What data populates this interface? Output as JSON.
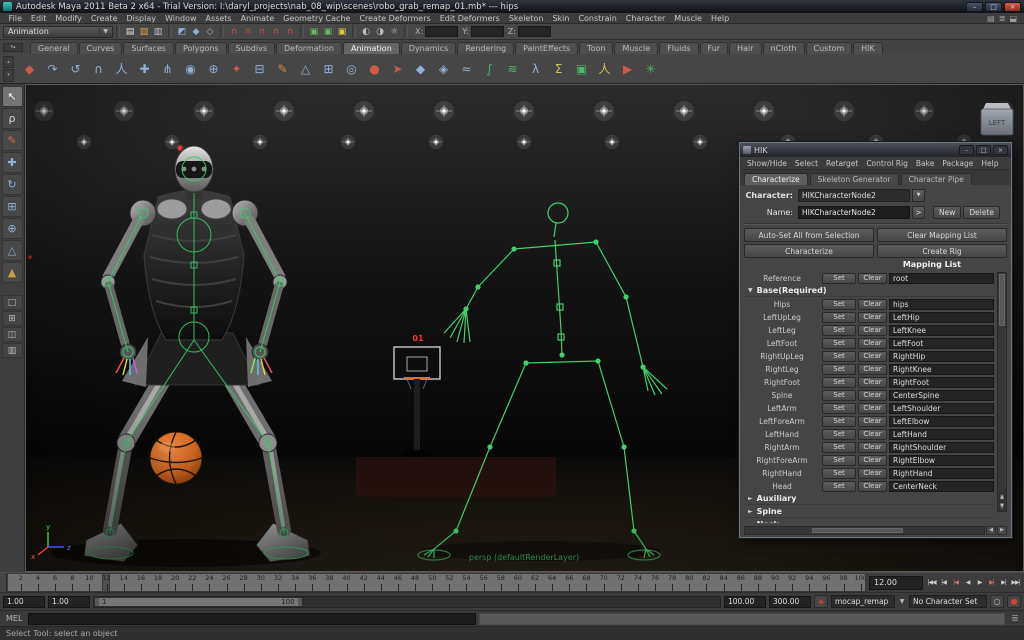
{
  "title_bar": {
    "title": "Autodesk Maya 2011 Beta 2 x64 - Trial Version: I:\\daryl_projects\\nab_08_wip\\scenes\\robo_grab_remap_01.mb*   ---   hips",
    "minimize": "–",
    "maximize": "□",
    "close": "×"
  },
  "menu_bar": {
    "items": [
      "File",
      "Edit",
      "Modify",
      "Create",
      "Display",
      "Window",
      "Assets",
      "Animate",
      "Geometry Cache",
      "Create Deformers",
      "Edit Deformers",
      "Skeleton",
      "Skin",
      "Constrain",
      "Character",
      "Muscle",
      "Help"
    ],
    "right_icons": [
      {
        "name": "toggle-attribute-editor-icon",
        "glyph": "▤",
        "color": "#a0a0a0"
      },
      {
        "name": "toggle-tool-settings-icon",
        "glyph": "≣",
        "color": "#a0a0a0"
      },
      {
        "name": "toggle-channel-box-icon",
        "glyph": "⬓",
        "color": "#a0a0a0"
      }
    ]
  },
  "status_line": {
    "menu_set": "Animation",
    "dropdown_arrow": "▼",
    "file_icons": [
      {
        "name": "new-scene-icon",
        "glyph": "▤",
        "color": "#e6e6e6"
      },
      {
        "name": "open-scene-icon",
        "glyph": "▨",
        "color": "#d9a94e"
      },
      {
        "name": "save-scene-icon",
        "glyph": "▥",
        "color": "#c2c2c2"
      }
    ],
    "selection_icons": [
      {
        "name": "select-by-hierarchy-icon",
        "glyph": "◩",
        "color": "#8fb4d9"
      },
      {
        "name": "select-by-object-icon",
        "glyph": "◆",
        "color": "#8fb4d9"
      },
      {
        "name": "select-by-component-icon",
        "glyph": "◇",
        "color": "#8fb4d9"
      }
    ],
    "snap_icons": [
      {
        "name": "snap-to-grids-icon",
        "glyph": "∩",
        "color": "#cf5040"
      },
      {
        "name": "snap-to-curves-icon",
        "glyph": "∩",
        "color": "#cf5040"
      },
      {
        "name": "snap-to-points-icon",
        "glyph": "∩",
        "color": "#cf5040"
      },
      {
        "name": "snap-to-projected-center-icon",
        "glyph": "∩",
        "color": "#cf5040"
      },
      {
        "name": "snap-to-view-planes-icon",
        "glyph": "∩",
        "color": "#cf5040"
      }
    ],
    "history_icons": [
      {
        "name": "input-connections-icon",
        "glyph": "▣",
        "color": "#69b769"
      },
      {
        "name": "output-connections-icon",
        "glyph": "▣",
        "color": "#69b769"
      },
      {
        "name": "construction-history-icon",
        "glyph": "▣",
        "color": "#d9c44e"
      }
    ],
    "render_icons": [
      {
        "name": "render-current-frame-icon",
        "glyph": "◐",
        "color": "#bdbdbd"
      },
      {
        "name": "ipr-render-icon",
        "glyph": "◑",
        "color": "#bdbdbd"
      },
      {
        "name": "render-settings-icon",
        "glyph": "☼",
        "color": "#bdbdbd"
      }
    ],
    "coords": [
      {
        "label": "X:"
      },
      {
        "label": "Y:"
      },
      {
        "label": "Z:"
      }
    ]
  },
  "shelf": {
    "tabs": [
      {
        "label": "General",
        "cls": "shelf-tab"
      },
      {
        "label": "Curves",
        "cls": "shelf-tab"
      },
      {
        "label": "Surfaces",
        "cls": "shelf-tab"
      },
      {
        "label": "Polygons",
        "cls": "shelf-tab"
      },
      {
        "label": "Subdivs",
        "cls": "shelf-tab"
      },
      {
        "label": "Deformation",
        "cls": "shelf-tab"
      },
      {
        "label": "Animation",
        "cls": "shelf-tab active"
      },
      {
        "label": "Dynamics",
        "cls": "shelf-tab"
      },
      {
        "label": "Rendering",
        "cls": "shelf-tab"
      },
      {
        "label": "PaintEffects",
        "cls": "shelf-tab"
      },
      {
        "label": "Toon",
        "cls": "shelf-tab"
      },
      {
        "label": "Muscle",
        "cls": "shelf-tab"
      },
      {
        "label": "Fluids",
        "cls": "shelf-tab"
      },
      {
        "label": "Fur",
        "cls": "shelf-tab"
      },
      {
        "label": "Hair",
        "cls": "shelf-tab"
      },
      {
        "label": "nCloth",
        "cls": "shelf-tab"
      },
      {
        "label": "Custom",
        "cls": "shelf-tab"
      },
      {
        "label": "HIK",
        "cls": "shelf-tab"
      }
    ],
    "icons": [
      {
        "name": "set-key-icon",
        "glyph": "◆",
        "color": "#cf5a4a"
      },
      {
        "name": "breakdown-key-icon",
        "glyph": "↷",
        "color": "#8fb0d8"
      },
      {
        "name": "ik-handle-icon",
        "glyph": "↺",
        "color": "#8fb0d8"
      },
      {
        "name": "ik-spline-icon",
        "glyph": "∩",
        "color": "#8fb0d8"
      },
      {
        "name": "joint-tool-icon",
        "glyph": "人",
        "color": "#8fb0d8"
      },
      {
        "name": "insert-joint-icon",
        "glyph": "✚",
        "color": "#8fb0d8"
      },
      {
        "name": "mirror-joint-icon",
        "glyph": "⋔",
        "color": "#8fb0d8"
      },
      {
        "name": "orient-joint-icon",
        "glyph": "◉",
        "color": "#8fb0d8"
      },
      {
        "name": "skeleton-icon",
        "glyph": "⊕",
        "color": "#8fb0d8"
      },
      {
        "name": "bind-skin-icon",
        "glyph": "✦",
        "color": "#cf5a4a"
      },
      {
        "name": "detach-skin-icon",
        "glyph": "⊟",
        "color": "#8fb0d8"
      },
      {
        "name": "paint-weights-icon",
        "glyph": "✎",
        "color": "#cf8a4a"
      },
      {
        "name": "blend-shape-icon",
        "glyph": "△",
        "color": "#8fb0d8"
      },
      {
        "name": "lattice-icon",
        "glyph": "⊞",
        "color": "#8fb0d8"
      },
      {
        "name": "cluster-icon",
        "glyph": "◎",
        "color": "#8fb0d8"
      },
      {
        "name": "point-constraint-icon",
        "glyph": "●",
        "color": "#cf5a4a"
      },
      {
        "name": "aim-constraint-icon",
        "glyph": "➤",
        "color": "#cf5a4a"
      },
      {
        "name": "orient-constraint-icon",
        "glyph": "◆",
        "color": "#8fb0d8"
      },
      {
        "name": "parent-constraint-icon",
        "glyph": "◈",
        "color": "#8fb0d8"
      },
      {
        "name": "motion-path-icon",
        "glyph": "≈",
        "color": "#8fb0d8"
      },
      {
        "name": "graph-editor-icon",
        "glyph": "∫",
        "color": "#4db865"
      },
      {
        "name": "dope-sheet-icon",
        "glyph": "≋",
        "color": "#4db865"
      },
      {
        "name": "trax-editor-icon",
        "glyph": "λ",
        "color": "#8fb0d8"
      },
      {
        "name": "expression-icon",
        "glyph": "Σ",
        "color": "#d8c050"
      },
      {
        "name": "create-clip-icon",
        "glyph": "▣",
        "color": "#4db865"
      },
      {
        "name": "character-set-icon",
        "glyph": "人",
        "color": "#d8c050"
      },
      {
        "name": "playblast-icon",
        "glyph": "▶",
        "color": "#cf5a4a"
      },
      {
        "name": "hik-shelf-icon",
        "glyph": "✳",
        "color": "#4db865"
      }
    ]
  },
  "toolbox": {
    "tools": [
      {
        "name": "select-tool",
        "glyph": "↖",
        "color": "#f0f0f0",
        "cls": "tool-cell active"
      },
      {
        "name": "lasso-tool",
        "glyph": "ρ",
        "color": "#d8d8d8",
        "cls": "tool-cell"
      },
      {
        "name": "paint-select-tool",
        "glyph": "✎",
        "color": "#cf6a4a",
        "cls": "tool-cell"
      },
      {
        "name": "move-tool",
        "glyph": "✚",
        "color": "#8fb0d8",
        "cls": "tool-cell"
      },
      {
        "name": "rotate-tool",
        "glyph": "↻",
        "color": "#8fb0d8",
        "cls": "tool-cell"
      },
      {
        "name": "scale-tool",
        "glyph": "⊞",
        "color": "#8fb0d8",
        "cls": "tool-cell"
      },
      {
        "name": "universal-manipulator-tool",
        "glyph": "⊕",
        "color": "#8fb0d8",
        "cls": "tool-cell"
      },
      {
        "name": "soft-modification-tool",
        "glyph": "△",
        "color": "#8fb0d8",
        "cls": "tool-cell"
      },
      {
        "name": "show-manipulator-tool",
        "glyph": "▲",
        "color": "#c8a040",
        "cls": "tool-cell"
      }
    ],
    "layouts": [
      {
        "name": "layout-single-pane-button",
        "glyph": "□"
      },
      {
        "name": "layout-four-pane-button",
        "glyph": "⊞"
      },
      {
        "name": "layout-two-pane-button",
        "glyph": "◫"
      },
      {
        "name": "layout-outliner-pane-button",
        "glyph": "▥"
      }
    ]
  },
  "viewport": {
    "view_cube_label": "LEFT",
    "camera_label": "persp (defaultRenderLayer)",
    "shot_clock": "01",
    "axis_y": "y",
    "axis_z": "z",
    "axis_x": "x"
  },
  "hik": {
    "window_title": "HIK",
    "minimize": "–",
    "maximize": "□",
    "close": "×",
    "menus": [
      "Show/Hide",
      "Select",
      "Retarget",
      "Control Rig",
      "Bake",
      "Package",
      "Help"
    ],
    "tabs": [
      {
        "label": "Characterize",
        "cls": "hik-tab active"
      },
      {
        "label": "Skeleton Generator",
        "cls": "hik-tab"
      },
      {
        "label": "Character Pipe",
        "cls": "hik-tab"
      }
    ],
    "character_label": "Character:",
    "character_value": "HIKCharacterNode2",
    "name_label": "Name:",
    "name_value": "HIKCharacterNode2",
    "expand_button": ">",
    "new_button": "New",
    "delete_button": "Delete",
    "auto_set_button": "Auto-Set All from Selection",
    "clear_mapping_button": "Clear Mapping List",
    "characterize_button": "Characterize",
    "create_rig_button": "Create Rig",
    "mapping_list_title": "Mapping List",
    "set_label": "Set",
    "clear_label": "Clear",
    "reference_label": "Reference",
    "reference_value": "root",
    "base_section": "Base(Required)",
    "rows": [
      {
        "label": "Hips",
        "value": "hips"
      },
      {
        "label": "LeftUpLeg",
        "value": "LeftHip"
      },
      {
        "label": "LeftLeg",
        "value": "LeftKnee"
      },
      {
        "label": "LeftFoot",
        "value": "LeftFoot"
      },
      {
        "label": "RightUpLeg",
        "value": "RightHip"
      },
      {
        "label": "RightLeg",
        "value": "RightKnee"
      },
      {
        "label": "RightFoot",
        "value": "RightFoot"
      },
      {
        "label": "Spine",
        "value": "CenterSpine"
      },
      {
        "label": "LeftArm",
        "value": "LeftShoulder"
      },
      {
        "label": "LeftForeArm",
        "value": "LeftElbow"
      },
      {
        "label": "LeftHand",
        "value": "LeftHand"
      },
      {
        "label": "RightArm",
        "value": "RightShoulder"
      },
      {
        "label": "RightForeArm",
        "value": "RightElbow"
      },
      {
        "label": "RightHand",
        "value": "RightHand"
      },
      {
        "label": "Head",
        "value": "CenterNeck"
      }
    ],
    "collapsed_sections": [
      "Auxiliary",
      "Spine",
      "Neck"
    ]
  },
  "timeline": {
    "start": 1,
    "end": 100,
    "label_step": 2,
    "current": 12,
    "current_display": "12.00",
    "playback_buttons": [
      {
        "name": "go-to-start-button",
        "glyph": "|◀◀",
        "cls": "pb-btn"
      },
      {
        "name": "step-back-key-button",
        "glyph": "|◀",
        "cls": "pb-btn"
      },
      {
        "name": "step-back-frame-button",
        "glyph": "|◀",
        "cls": "pb-btn red"
      },
      {
        "name": "play-backwards-button",
        "glyph": "◀",
        "cls": "pb-btn"
      },
      {
        "name": "play-forwards-button",
        "glyph": "▶",
        "cls": "pb-btn"
      },
      {
        "name": "step-forward-frame-button",
        "glyph": "▶|",
        "cls": "pb-btn red"
      },
      {
        "name": "step-forward-key-button",
        "glyph": "▶|",
        "cls": "pb-btn"
      },
      {
        "name": "go-to-end-button",
        "glyph": "▶▶|",
        "cls": "pb-btn"
      }
    ]
  },
  "range_slider": {
    "anim_start": "1.00",
    "playback_start": "1.00",
    "thumb_start_label": "1",
    "thumb_end_label": "100",
    "playback_end": "100.00",
    "anim_end": "300.00",
    "character_icon": "◈",
    "character_menu": "mocap_remap",
    "dropdown_arrow": "▼",
    "character_set": "No Character Set",
    "key_icon": "○",
    "autokey_icon": "●"
  },
  "command_line": {
    "label": "MEL"
  },
  "help_line": {
    "text": "Select Tool: select an object"
  },
  "colors": {
    "accent_green": "#3ec968",
    "ball_orange": "#e2701f",
    "autokey_red": "#cc4436"
  }
}
